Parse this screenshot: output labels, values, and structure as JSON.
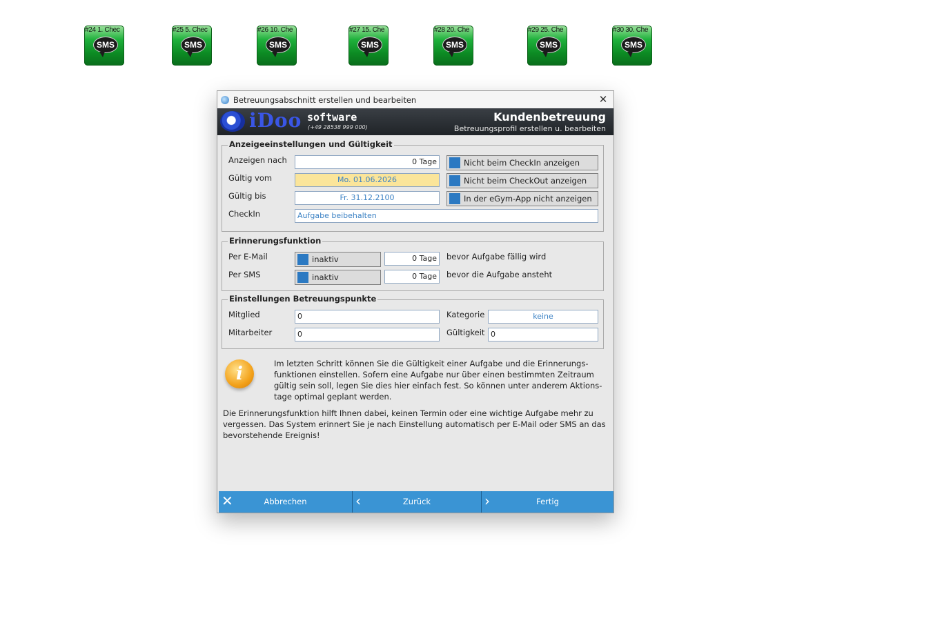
{
  "desktop": {
    "icons": [
      {
        "caption": "#24 1. Chec",
        "badge": "SMS"
      },
      {
        "caption": "#25 5. Chec",
        "badge": "SMS"
      },
      {
        "caption": "#26 10. Che",
        "badge": "SMS"
      },
      {
        "caption": "#27 15. Che",
        "badge": "SMS"
      },
      {
        "caption": "#28 20. Che",
        "badge": "SMS"
      },
      {
        "caption": "#29 25. Che",
        "badge": "SMS"
      },
      {
        "caption": "#30 30. Che",
        "badge": "SMS"
      }
    ]
  },
  "dialog": {
    "title": "Betreuungsabschnitt erstellen und bearbeiten",
    "close_glyph": "✕"
  },
  "banner": {
    "logo_text": "iDoo",
    "software": "software",
    "phone": "(+49 28538 999 000)",
    "title": "Kundenbetreuung",
    "subtitle": "Betreuungsprofil erstellen u. bearbeiten"
  },
  "display": {
    "legend": "Anzeigeeinstellungen und Gültigkeit",
    "show_after_label": "Anzeigen nach",
    "show_after_value": "0 Tage",
    "valid_from_label": "Gültig vom",
    "valid_from_value": "Mo. 01.06.2026",
    "valid_to_label": "Gültig bis",
    "valid_to_value": "Fr. 31.12.2100",
    "checkin_label": "CheckIn",
    "checkin_value": "Aufgabe beibehalten",
    "opt_checkin": "Nicht beim CheckIn anzeigen",
    "opt_checkout": "Nicht beim CheckOut anzeigen",
    "opt_egym": "In der eGym-App nicht anzeigen"
  },
  "reminder": {
    "legend": "Erinnerungsfunktion",
    "email_label": "Per E-Mail",
    "email_state": "inaktiv",
    "email_days": "0 Tage",
    "email_suffix": "bevor Aufgabe fällig wird",
    "sms_label": "Per SMS",
    "sms_state": "inaktiv",
    "sms_days": "0 Tage",
    "sms_suffix": "bevor die Aufgabe ansteht"
  },
  "points": {
    "legend": "Einstellungen Betreuungspunkte",
    "member_label": "Mitglied",
    "member_value": "0",
    "employee_label": "Mitarbeiter",
    "employee_value": "0",
    "category_label": "Kategorie",
    "category_value": "keine",
    "validity_label": "Gültigkeit",
    "validity_value": "0"
  },
  "info": {
    "icon": "i",
    "text1": "Im letzten Schritt können Sie die Gültigkeit einer Aufgabe und die Erinnerungs-funktionen einstellen. Sofern eine Aufgabe nur über einen bestimmten Zeitraum gültig sein soll, legen Sie dies hier einfach fest. So können unter anderem Aktions-tage optimal geplant werden.",
    "text2": "Die Erinnerungsfunktion hilft Ihnen dabei, keinen Termin oder eine wichtige Aufgabe mehr zu vergessen. Das System erinnert Sie je nach Einstellung automatisch per E-Mail oder SMS an das bevorstehende Ereignis!"
  },
  "footer": {
    "cancel": "Abbrechen",
    "cancel_icon": "✕",
    "back": "Zurück",
    "back_icon": "‹",
    "finish": "Fertig",
    "finish_icon": "›"
  }
}
